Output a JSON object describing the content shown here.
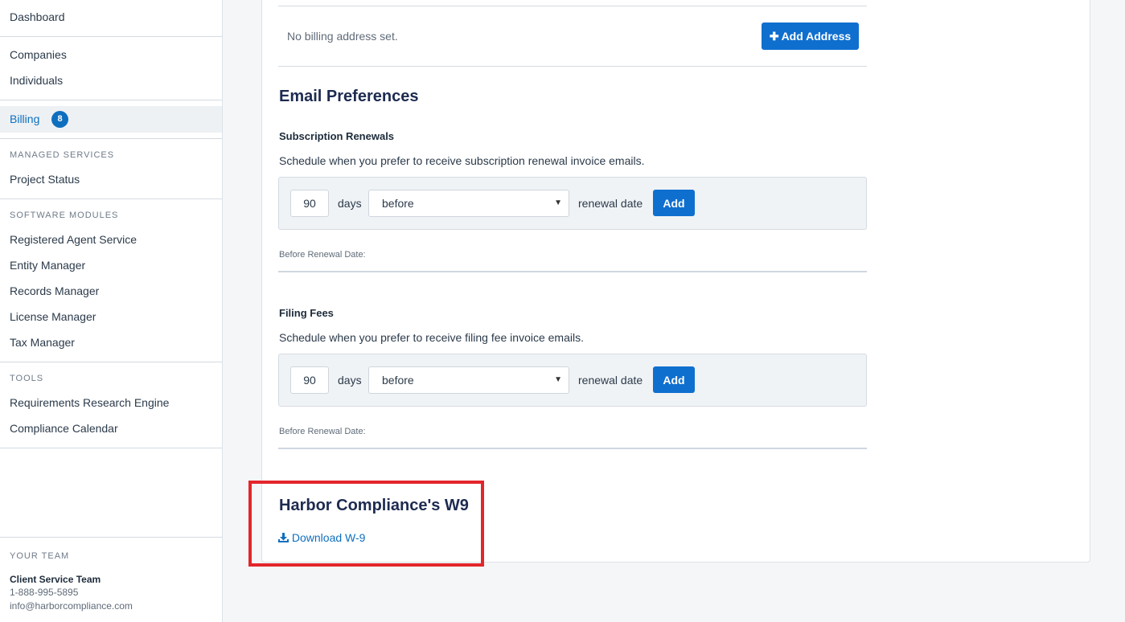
{
  "sidebar": {
    "dashboard": "Dashboard",
    "companies": "Companies",
    "individuals": "Individuals",
    "billing": {
      "label": "Billing",
      "badge": "8"
    },
    "managed_services": {
      "heading": "MANAGED SERVICES",
      "items": [
        "Project Status"
      ]
    },
    "software_modules": {
      "heading": "SOFTWARE MODULES",
      "items": [
        "Registered Agent Service",
        "Entity Manager",
        "Records Manager",
        "License Manager",
        "Tax Manager"
      ]
    },
    "tools": {
      "heading": "TOOLS",
      "items": [
        "Requirements Research Engine",
        "Compliance Calendar"
      ]
    },
    "your_team": {
      "heading": "YOUR TEAM",
      "name": "Client Service Team",
      "phone": "1-888-995-5895",
      "email": "info@harborcompliance.com"
    }
  },
  "billing_address": {
    "empty_text": "No billing address set.",
    "add_button": "Add Address"
  },
  "email_preferences": {
    "title": "Email Preferences",
    "subscription": {
      "title": "Subscription Renewals",
      "description": "Schedule when you prefer to receive subscription renewal invoice emails.",
      "days_value": "90",
      "days_label": "days",
      "timing": "before",
      "suffix": "renewal date",
      "add_button": "Add",
      "list_label": "Before Renewal Date:"
    },
    "filing_fees": {
      "title": "Filing Fees",
      "description": "Schedule when you prefer to receive filing fee invoice emails.",
      "days_value": "90",
      "days_label": "days",
      "timing": "before",
      "suffix": "renewal date",
      "add_button": "Add",
      "list_label": "Before Renewal Date:"
    }
  },
  "w9": {
    "title": "Harbor Compliance's W9",
    "download_link": "Download W-9"
  },
  "colors": {
    "accent": "#0f6fcf",
    "highlight": "#e3262b",
    "sidebar_active_bg": "#eef1f4"
  }
}
